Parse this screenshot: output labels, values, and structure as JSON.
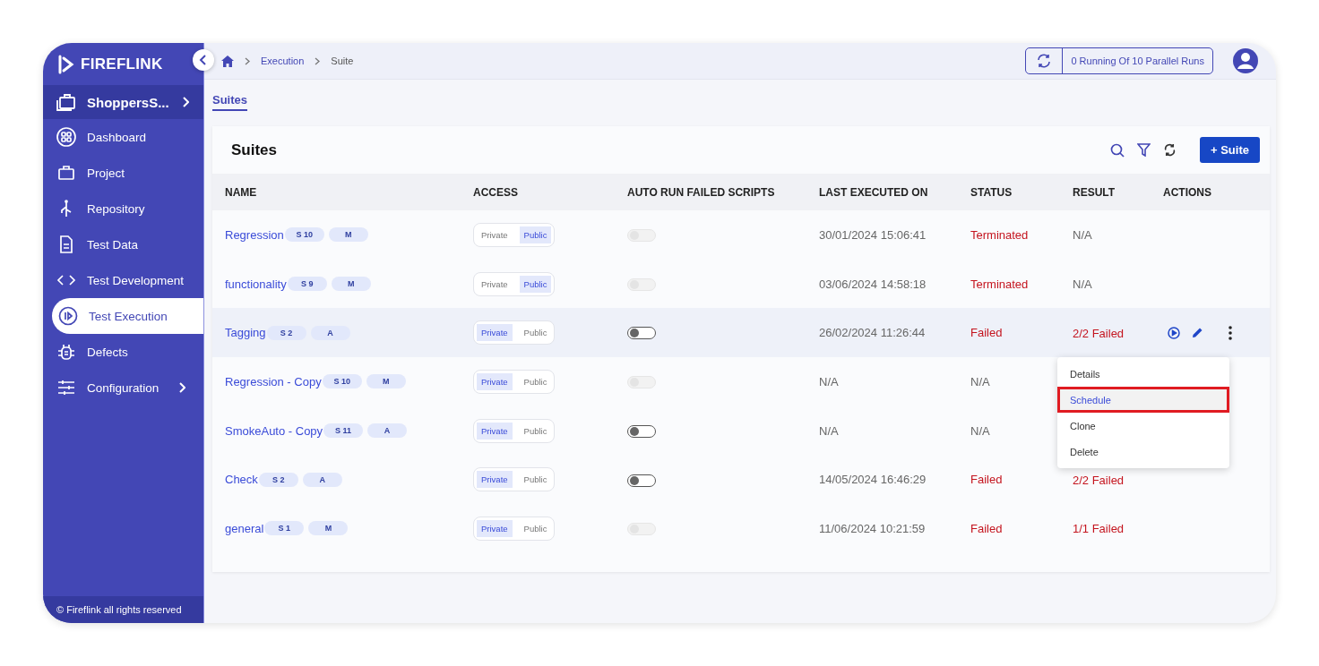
{
  "sidebar": {
    "logo": "FIREFLINK",
    "project": "ShoppersS...",
    "items": [
      {
        "label": "Dashboard",
        "selected": false,
        "expandable": false
      },
      {
        "label": "Project",
        "selected": false,
        "expandable": false
      },
      {
        "label": "Repository",
        "selected": false,
        "expandable": false
      },
      {
        "label": "Test Data",
        "selected": false,
        "expandable": false
      },
      {
        "label": "Test Development",
        "selected": false,
        "expandable": false
      },
      {
        "label": "Test Execution",
        "selected": true,
        "expandable": false
      },
      {
        "label": "Defects",
        "selected": false,
        "expandable": false
      },
      {
        "label": "Configuration",
        "selected": false,
        "expandable": true
      }
    ],
    "footer": "© Fireflink all rights reserved"
  },
  "breadcrumb": [
    "Execution",
    "Suite"
  ],
  "parallel_runs": "0 Running Of 10 Parallel Runs",
  "tabs": [
    {
      "label": "Suites",
      "selected": true
    }
  ],
  "card": {
    "title": "Suites",
    "add_button": "+ Suite"
  },
  "table": {
    "columns": [
      "NAME",
      "ACCESS",
      "AUTO RUN FAILED SCRIPTS",
      "LAST EXECUTED ON",
      "STATUS",
      "RESULT",
      "ACTIONS"
    ],
    "rows": [
      {
        "name": "Regression",
        "badges": [
          "S 10",
          "M"
        ],
        "access": [
          {
            "label": "Private",
            "selected": false
          },
          {
            "label": "Public",
            "selected": true
          }
        ],
        "auto_run_disabled": true,
        "last_executed": "30/01/2024 15:06:41",
        "status": {
          "text": "Terminated",
          "kind": "failed"
        },
        "result": {
          "text": "N/A",
          "kind": "none"
        },
        "highlighted": false,
        "actions": false
      },
      {
        "name": "functionality",
        "badges": [
          "S 9",
          "M"
        ],
        "access": [
          {
            "label": "Private",
            "selected": false
          },
          {
            "label": "Public",
            "selected": true
          }
        ],
        "auto_run_disabled": true,
        "last_executed": "03/06/2024 14:58:18",
        "status": {
          "text": "Terminated",
          "kind": "failed"
        },
        "result": {
          "text": "N/A",
          "kind": "none"
        },
        "highlighted": false,
        "actions": false
      },
      {
        "name": "Tagging",
        "badges": [
          "S 2",
          "A"
        ],
        "access": [
          {
            "label": "Private",
            "selected": true
          },
          {
            "label": "Public",
            "selected": false
          }
        ],
        "auto_run_disabled": false,
        "last_executed": "26/02/2024 11:26:44",
        "status": {
          "text": "Failed",
          "kind": "failed"
        },
        "result": {
          "text": "2/2 Failed",
          "kind": "failed"
        },
        "highlighted": true,
        "actions": true
      },
      {
        "name": "Regression - Copy",
        "badges": [
          "S 10",
          "M"
        ],
        "access": [
          {
            "label": "Private",
            "selected": true
          },
          {
            "label": "Public",
            "selected": false
          }
        ],
        "auto_run_disabled": true,
        "last_executed": "N/A",
        "status": {
          "text": "N/A",
          "kind": "none"
        },
        "highlighted": false,
        "actions": false
      },
      {
        "name": "SmokeAuto - Copy",
        "badges": [
          "S 11",
          "A"
        ],
        "access": [
          {
            "label": "Private",
            "selected": true
          },
          {
            "label": "Public",
            "selected": false
          }
        ],
        "auto_run_disabled": false,
        "last_executed": "N/A",
        "status": {
          "text": "N/A",
          "kind": "none"
        },
        "highlighted": false,
        "actions": false
      },
      {
        "name": "Check",
        "badges": [
          "S 2",
          "A"
        ],
        "access": [
          {
            "label": "Private",
            "selected": true
          },
          {
            "label": "Public",
            "selected": false
          }
        ],
        "auto_run_disabled": false,
        "last_executed": "14/05/2024 16:46:29",
        "status": {
          "text": "Failed",
          "kind": "failed"
        },
        "result": {
          "text": "2/2 Failed",
          "kind": "failed"
        },
        "highlighted": false,
        "actions": false
      },
      {
        "name": "general",
        "badges": [
          "S 1",
          "M"
        ],
        "access": [
          {
            "label": "Private",
            "selected": true
          },
          {
            "label": "Public",
            "selected": false
          }
        ],
        "auto_run_disabled": true,
        "last_executed": "11/06/2024 10:21:59",
        "status": {
          "text": "Failed",
          "kind": "failed"
        },
        "result": {
          "text": "1/1 Failed",
          "kind": "failed"
        },
        "highlighted": false,
        "actions": false
      }
    ]
  },
  "menu": [
    {
      "label": "Details",
      "selected": false
    },
    {
      "label": "Schedule",
      "selected": true
    },
    {
      "label": "Clone",
      "selected": false
    },
    {
      "label": "Delete",
      "selected": false
    }
  ]
}
